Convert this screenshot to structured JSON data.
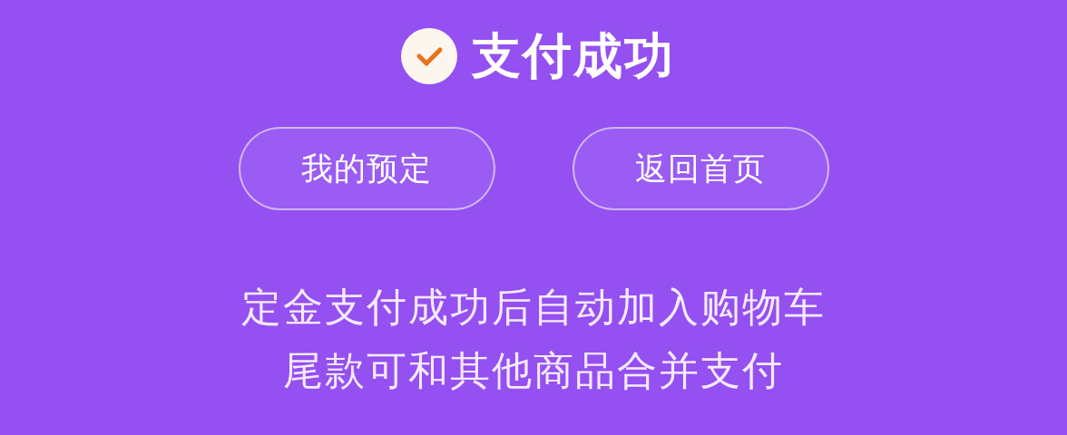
{
  "result": {
    "title": "支付成功"
  },
  "buttons": [
    {
      "label": "我的预定"
    },
    {
      "label": "返回首页"
    }
  ],
  "notice_lines": [
    "定金支付成功后自动加入购物车",
    "尾款可和其他商品合并支付"
  ]
}
